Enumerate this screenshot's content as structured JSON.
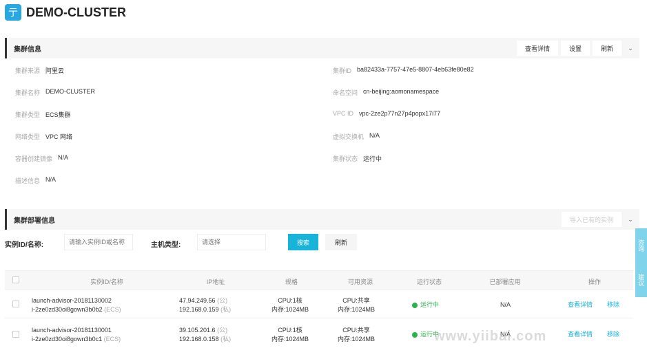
{
  "header": {
    "logo_glyph": "亍",
    "title": "DEMO-CLUSTER"
  },
  "cluster_info": {
    "title": "集群信息",
    "actions": {
      "details": "查看详情",
      "settings": "设置",
      "refresh": "刷新"
    },
    "left": [
      {
        "label": "集群来源",
        "value": "阿里云"
      },
      {
        "label": "集群名称",
        "value": "DEMO-CLUSTER"
      },
      {
        "label": "集群类型",
        "value": "ECS集群"
      },
      {
        "label": "网络类型",
        "value": "VPC 网络"
      },
      {
        "label": "容器创建镜像",
        "value": "N/A"
      },
      {
        "label": "描述信息",
        "value": "N/A"
      }
    ],
    "right": [
      {
        "label": "集群ID",
        "value": "ba82433a-7757-47e5-8807-4eb63fe80e82"
      },
      {
        "label": "命名空间",
        "value": "cn-beijing:aomonamespace"
      },
      {
        "label": "VPC ID",
        "value": "vpc-2ze2p77n27p4popx17i77"
      },
      {
        "label": "虚拟交换机",
        "value": "N/A"
      },
      {
        "label": "集群状态",
        "value": "运行中"
      }
    ]
  },
  "deploy_info": {
    "title": "集群部署信息",
    "dropdown_label": "导入已有的实例",
    "filter": {
      "instance_label": "实例ID/名称:",
      "instance_placeholder": "请输入实例ID或名称",
      "host_label": "主机类型:",
      "host_placeholder": "请选择",
      "search_label": "搜索",
      "refresh_label": "刷新"
    },
    "columns": [
      "实例ID/名称",
      "IP地址",
      "规格",
      "可用资源",
      "运行状态",
      "已部署应用",
      "操作"
    ],
    "rows": [
      {
        "name": "launch-advisor-20181130002",
        "id": "i-2ze0zd30oi8gown3b0b2",
        "id_tag": "(ECS)",
        "ip_public": "47.94.249.56",
        "ip_public_tag": "(公)",
        "ip_private": "192.168.0.159",
        "ip_private_tag": "(私)",
        "spec_cpu": "CPU:1核",
        "spec_mem": "内存:1024MB",
        "res_cpu": "CPU:共享",
        "res_mem": "内存:1024MB",
        "status": "运行中",
        "apps": "N/A",
        "action_details": "查看详情",
        "action_remove": "移除"
      },
      {
        "name": "launch-advisor-20181130001",
        "id": "i-2ze0zd30oi8gown3b0c1",
        "id_tag": "(ECS)",
        "ip_public": "39.105.201.6",
        "ip_public_tag": "(公)",
        "ip_private": "192.168.0.158",
        "ip_private_tag": "(私)",
        "spec_cpu": "CPU:1核",
        "spec_mem": "内存:1024MB",
        "res_cpu": "CPU:共享",
        "res_mem": "内存:1024MB",
        "status": "运行中",
        "apps": "N/A",
        "action_details": "查看详情",
        "action_remove": "移除"
      }
    ]
  },
  "side_tab": {
    "a": "咨询",
    "b": "建议"
  },
  "watermark": "www.yiibai.com",
  "colors": {
    "accent": "#17b3d9",
    "running": "#2bb24c",
    "logo": "#29a7e1"
  }
}
